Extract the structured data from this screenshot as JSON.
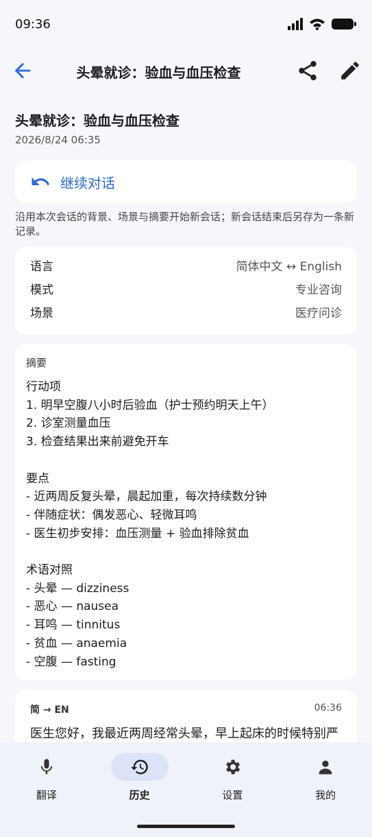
{
  "status": {
    "time": "09:36"
  },
  "topbar": {
    "title": "头晕就诊：验血与血压检查"
  },
  "page": {
    "heading": "头晕就诊：验血与血压检查",
    "date": "2026/8/24 06:35"
  },
  "continue": {
    "label": "继续对话"
  },
  "hint": "沿用本次会话的背景、场景与摘要开始新会话；新会话结束后另存为一条新记录。",
  "meta": [
    {
      "key": "语言",
      "value": "简体中文 ↔ English"
    },
    {
      "key": "模式",
      "value": "专业咨询"
    },
    {
      "key": "场景",
      "value": "医疗问诊"
    }
  ],
  "summary": {
    "title": "摘要",
    "body": "行动项\n1. 明早空腹八小时后验血（护士预约明天上午）\n2. 诊室测量血压\n3. 检查结果出来前避免开车\n\n要点\n- 近两周反复头晕，晨起加重，每次持续数分钟\n- 伴随症状：偶发恶心、轻微耳鸣\n- 医生初步安排：血压测量 + 验血排除贫血\n\n术语对照\n- 头晕 — dizziness\n- 恶心 — nausea\n- 耳鸣 — tinnitus\n- 贫血 — anaemia\n- 空腹 — fasting"
  },
  "message": {
    "direction": "简 → EN",
    "time": "06:36",
    "text": "医生您好，我最近两周经常头晕，早上起床的时候特别严重。"
  },
  "nav": [
    {
      "label": "翻译",
      "icon": "mic-icon"
    },
    {
      "label": "历史",
      "icon": "history-icon"
    },
    {
      "label": "设置",
      "icon": "gear-icon"
    },
    {
      "label": "我的",
      "icon": "person-icon"
    }
  ],
  "colors": {
    "accent": "#2c6bd6",
    "nav_active": "#dce3f6",
    "background": "#f5f7fb"
  }
}
